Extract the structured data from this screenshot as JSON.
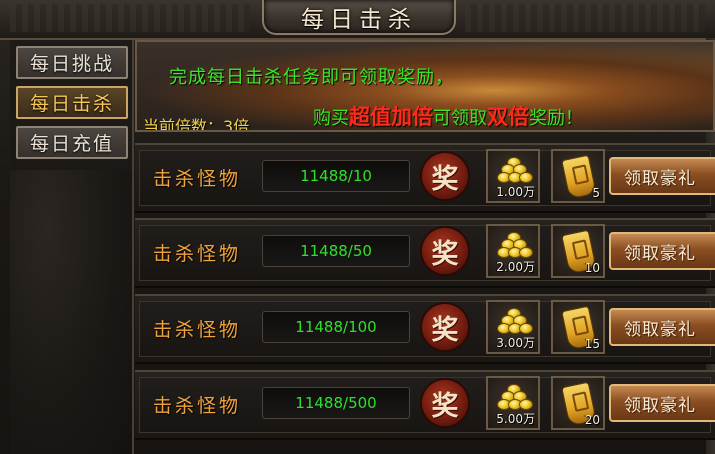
{
  "window": {
    "title": "每日击杀"
  },
  "sidebar": {
    "tabs": [
      {
        "label": "每日挑战"
      },
      {
        "label": "每日击杀"
      },
      {
        "label": "每日充值"
      }
    ],
    "active_index": 1
  },
  "banner": {
    "line1": "完成每日击杀任务即可领取奖励，",
    "multiplier_label": "当前倍数：",
    "multiplier_value": "3倍",
    "line2_parts": {
      "a": "购买",
      "b": "超值加倍",
      "c": "可领取",
      "d": "双倍",
      "e": "奖励！"
    },
    "colors": {
      "green": "#39e62b",
      "red": "#ff2a1a",
      "yellow": "#f2d24a"
    }
  },
  "tasks": [
    {
      "label": "击杀怪物",
      "progress": "11488/10",
      "badge": "奖",
      "gold_amount": "1.00万",
      "token_count": "5",
      "claim_label": "领取豪礼"
    },
    {
      "label": "击杀怪物",
      "progress": "11488/50",
      "badge": "奖",
      "gold_amount": "2.00万",
      "token_count": "10",
      "claim_label": "领取豪礼"
    },
    {
      "label": "击杀怪物",
      "progress": "11488/100",
      "badge": "奖",
      "gold_amount": "3.00万",
      "token_count": "15",
      "claim_label": "领取豪礼"
    },
    {
      "label": "击杀怪物",
      "progress": "11488/500",
      "badge": "奖",
      "gold_amount": "5.00万",
      "token_count": "20",
      "claim_label": "领取豪礼"
    }
  ],
  "icons": {
    "gold": "gold-coins-icon",
    "token": "gold-token-icon",
    "badge": "reward-seal-icon"
  }
}
